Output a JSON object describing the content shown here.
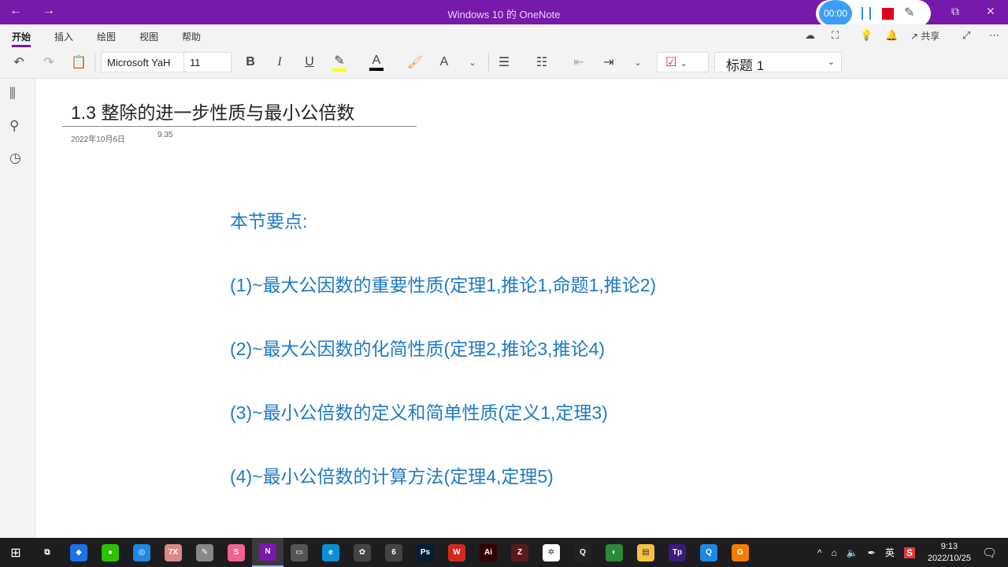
{
  "titlebar": {
    "title": "Windows 10 的 OneNote",
    "back": "←",
    "forward": "→",
    "restore": "⧉",
    "close": "✕"
  },
  "recorder": {
    "timer": "00:00"
  },
  "ribbon": {
    "tabs": [
      "开始",
      "插入",
      "绘图",
      "视图",
      "帮助"
    ],
    "share_label": "共享",
    "font_name": "Microsoft YaH",
    "font_size": "11",
    "style": "标题 1",
    "highlight_color": "#ffff00",
    "font_color": "#000000"
  },
  "page": {
    "title": "1.3 整除的进一步性质与最小公倍数",
    "date": "2022年10月6日",
    "time": "9:35",
    "lines": [
      "本节要点:",
      "(1)~最大公因数的重要性质(定理1,推论1,命题1,推论2)",
      "(2)~最大公因数的化简性质(定理2,推论3,推论4)",
      "(3)~最小公倍数的定义和简单性质(定义1,定理3)",
      "(4)~最小公倍数的计算方法(定理4,定理5)"
    ],
    "text_color": "#1f7ac4"
  },
  "taskbar": {
    "apps": [
      {
        "name": "task-view",
        "label": "⧉",
        "bg": "transparent"
      },
      {
        "name": "feishu",
        "label": "◆",
        "bg": "#1a73e8"
      },
      {
        "name": "wechat",
        "label": "●",
        "bg": "#2dc100"
      },
      {
        "name": "browser",
        "label": "◎",
        "bg": "#1e88e5"
      },
      {
        "name": "7x",
        "label": "7X",
        "bg": "#d88"
      },
      {
        "name": "paint",
        "label": "✎",
        "bg": "#888"
      },
      {
        "name": "sai",
        "label": "S",
        "bg": "#f06292"
      },
      {
        "name": "onenote",
        "label": "N",
        "bg": "#7719aa"
      },
      {
        "name": "monitor",
        "label": "▭",
        "bg": "#555"
      },
      {
        "name": "edge",
        "label": "e",
        "bg": "#0c8ed9"
      },
      {
        "name": "flower",
        "label": "✿",
        "bg": "#444"
      },
      {
        "name": "app6",
        "label": "6",
        "bg": "#444"
      },
      {
        "name": "photoshop",
        "label": "Ps",
        "bg": "#001e36"
      },
      {
        "name": "wps",
        "label": "W",
        "bg": "#d42a1e"
      },
      {
        "name": "illustrator",
        "label": "Ai",
        "bg": "#330000"
      },
      {
        "name": "app-z",
        "label": "Z",
        "bg": "#5a1a1a"
      },
      {
        "name": "settings",
        "label": "✲",
        "bg": "#fff"
      },
      {
        "name": "qq",
        "label": "Q",
        "bg": "#222"
      },
      {
        "name": "app-green",
        "label": "◐",
        "bg": "#2a8a3a"
      },
      {
        "name": "explorer",
        "label": "▤",
        "bg": "#f5c242"
      },
      {
        "name": "app-purple",
        "label": "Tp",
        "bg": "#3a1a7a"
      },
      {
        "name": "app-q",
        "label": "Q",
        "bg": "#1e88e5"
      },
      {
        "name": "app-g",
        "label": "G",
        "bg": "#f57c00"
      }
    ],
    "tray": {
      "chevron": "^",
      "ime": "英",
      "time": "9:13",
      "date": "2022/10/25"
    }
  }
}
